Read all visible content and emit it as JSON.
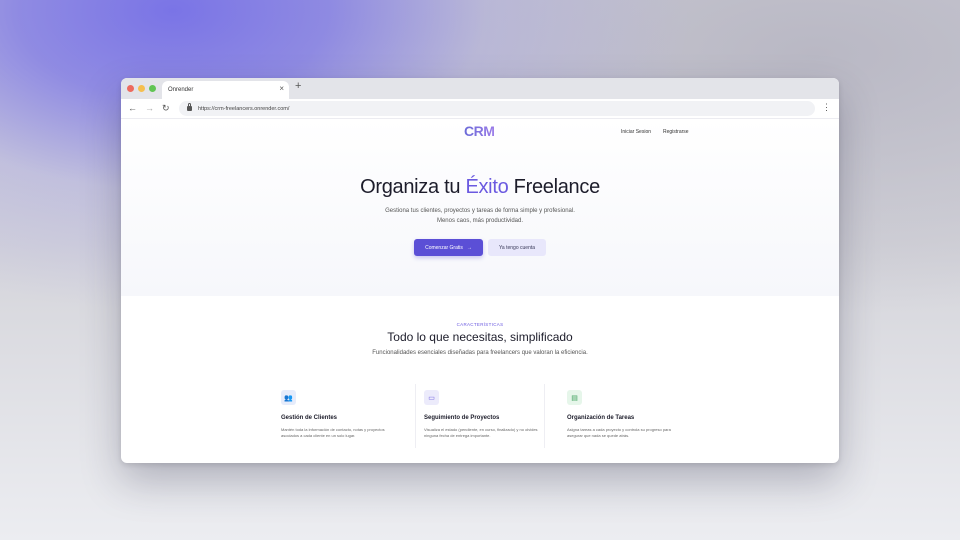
{
  "browser": {
    "tab_title": "Onrender",
    "tab_close": "×",
    "new_tab": "+",
    "url": "https://crm-freelancers.onrender.com/",
    "back": "←",
    "forward": "→",
    "reload": "↻",
    "menu": "⋮"
  },
  "header": {
    "logo": "CRM",
    "login": "Iniciar Sesion",
    "register": "Registrarse"
  },
  "hero": {
    "title_part1": "Organiza tu ",
    "title_accent": "Éxito",
    "title_part2": " Freelance",
    "subtitle_line1": "Gestiona tus clientes, proyectos y tareas de forma simple y profesional.",
    "subtitle_line2": "Menos caos, más productividad.",
    "primary_button": "Comenzar Gratis",
    "primary_arrow": "→",
    "secondary_button": "Ya tengo cuenta"
  },
  "features": {
    "eyebrow": "CARACTERÍSTICAS",
    "title": "Todo lo que necesitas, simplificado",
    "subtitle": "Funcionalidades esenciales diseñadas para freelancers que valoran la eficiencia.",
    "cards": [
      {
        "icon": "users-icon",
        "glyph": "👥",
        "title": "Gestión de Clientes",
        "description": "Mantén toda la información de contacto, notas y proyectos asociados a cada cliente en un solo lugar."
      },
      {
        "icon": "briefcase-icon",
        "glyph": "▭",
        "title": "Seguimiento de Proyectos",
        "description": "Visualiza el estado (pendiente, en curso, finalizado) y no olvides ninguna fecha de entrega importante."
      },
      {
        "icon": "clipboard-icon",
        "glyph": "▤",
        "title": "Organización de Tareas",
        "description": "Asigna tareas a cada proyecto y controla su progreso para asegurar que nada se quede atrás."
      }
    ]
  },
  "colors": {
    "accent": "#5b4fd6",
    "accent_light": "#e8e7fb",
    "card_icon_bg_1": "#e6ecfb",
    "card_icon_bg_2": "#ecebfb",
    "card_icon_bg_3": "#e6f6ea"
  }
}
